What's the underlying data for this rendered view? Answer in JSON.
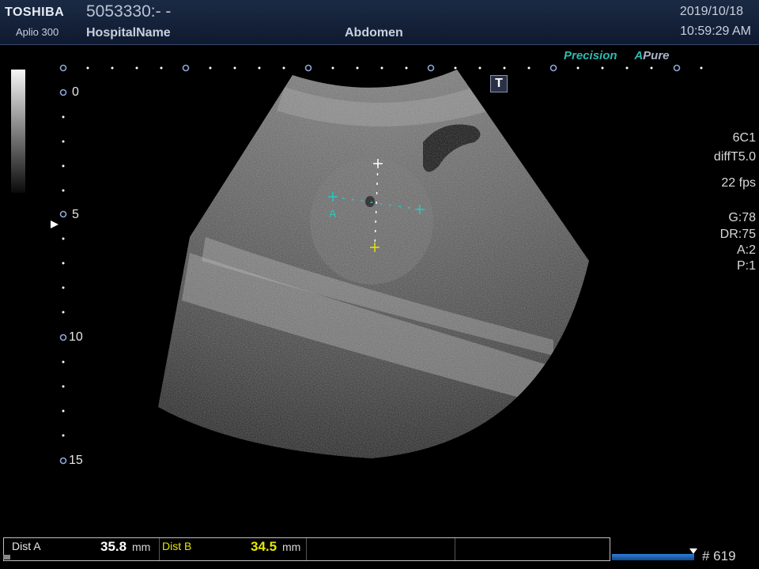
{
  "header": {
    "brand": "TOSHIBA",
    "model": "Aplio 300",
    "patient_id": "5053330:- -",
    "hospital": "HospitalName",
    "exam": "Abdomen",
    "date": "2019/10/18",
    "time": "10:59:29 AM"
  },
  "mode_tags": {
    "precision": "Precision",
    "a_letter": "A",
    "pure": "Pure"
  },
  "depth_scale": {
    "labels": [
      "0",
      "5",
      "10",
      "15"
    ]
  },
  "t_badge": "T",
  "params": {
    "probe": "6C1",
    "preset": "diffT5.0",
    "fps": "22 fps",
    "gain": "G:78",
    "dr": "DR:75",
    "a": "A:2",
    "p": "P:1"
  },
  "calipers": {
    "label_a": "A"
  },
  "measurements": {
    "dist_a_label": "Dist A",
    "dist_a_value": "35.8",
    "dist_a_unit": "mm",
    "dist_b_label": "Dist B",
    "dist_b_value": "34.5",
    "dist_b_unit": "mm"
  },
  "frame": {
    "number": "# 619"
  },
  "colors": {
    "caliper_a": "#26c9c0",
    "caliper_b": "#e6e600",
    "accent_teal": "#2fb9b0",
    "header_bg": "#1b2a44"
  }
}
